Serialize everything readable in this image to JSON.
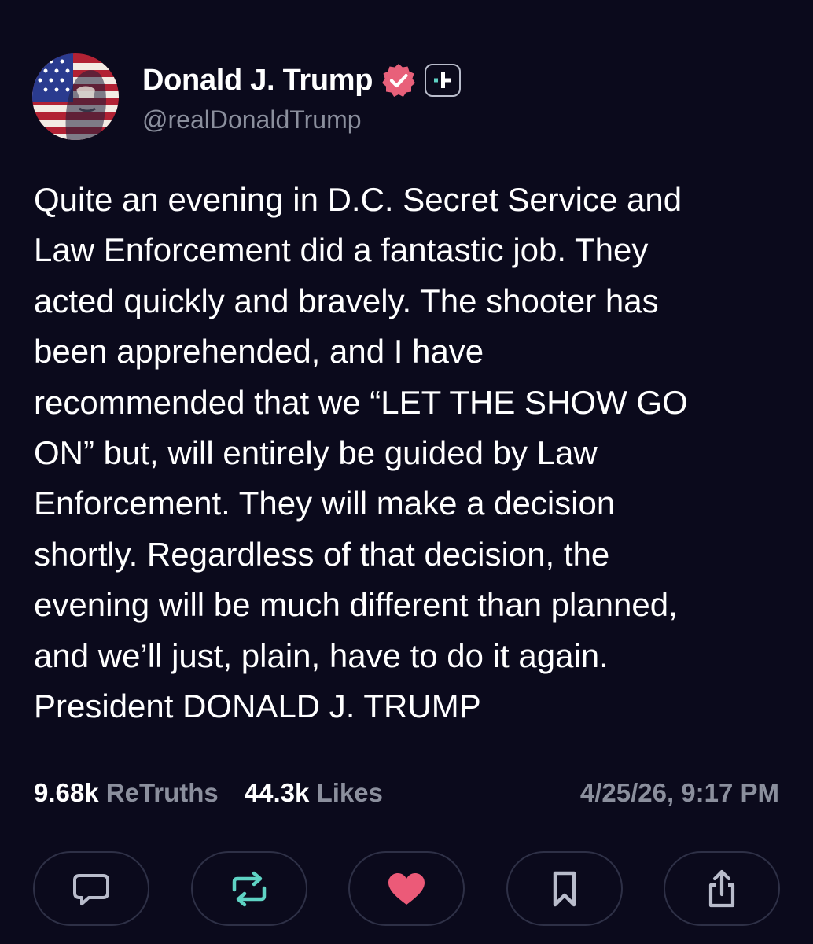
{
  "author": {
    "display_name": "Donald J. Trump",
    "handle": "@realDonaldTrump",
    "avatar_icon": "flag-portrait-avatar",
    "verified_icon": "verified-badge-icon",
    "verified_color": "#e8607a",
    "plus_icon": "plus-badge-icon"
  },
  "post": {
    "lines": [
      "Quite an evening in D.C. Secret Service and",
      "Law Enforcement did a fantastic job. They",
      "acted quickly and bravely. The shooter has",
      "been apprehended, and I have",
      "recommended that we “LET THE SHOW GO",
      "ON” but, will entirely be guided by Law",
      "Enforcement. They will make a decision",
      "shortly. Regardless of that decision, the",
      "evening will be much different than planned,",
      "and we’ll just, plain, have to do it again.",
      "President DONALD J. TRUMP"
    ]
  },
  "stats": {
    "retruths_count": "9.68k",
    "retruths_label": "ReTruths",
    "likes_count": "44.3k",
    "likes_label": "Likes",
    "timestamp": "4/25/26, 9:17 PM"
  },
  "actions": [
    {
      "icon": "reply-icon",
      "color": "#b9bccb"
    },
    {
      "icon": "retruth-icon",
      "color": "#5fd3c4"
    },
    {
      "icon": "heart-icon",
      "color": "#ec5a78"
    },
    {
      "icon": "bookmark-icon",
      "color": "#b9bccb"
    },
    {
      "icon": "share-icon",
      "color": "#b9bccb"
    }
  ],
  "colors": {
    "background": "#0b0a1c",
    "text": "#ffffff",
    "muted": "#8b8f9d",
    "button_border": "#2e3046"
  }
}
